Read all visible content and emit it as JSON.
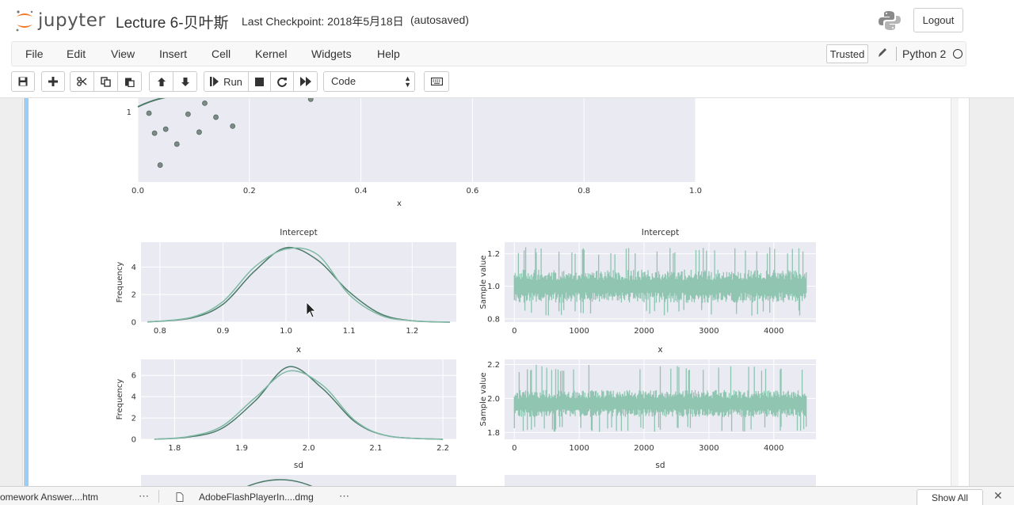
{
  "header": {
    "logo_text": "jupyter",
    "notebook_name": "Lecture 6-贝叶斯",
    "checkpoint": "Last Checkpoint: 2018年5月18日",
    "autosave_status": "(autosaved)",
    "logout_label": "Logout"
  },
  "menubar": {
    "items": [
      "File",
      "Edit",
      "View",
      "Insert",
      "Cell",
      "Kernel",
      "Widgets",
      "Help"
    ],
    "trusted_label": "Trusted",
    "kernel_name": "Python 2"
  },
  "toolbar": {
    "run_label": "Run",
    "cell_type": "Code",
    "icons": [
      "save-icon",
      "plus-icon",
      "scissors-icon",
      "copy-icon",
      "paste-icon",
      "arrow-up-icon",
      "arrow-down-icon",
      "run-icon",
      "stop-icon",
      "restart-icon",
      "fast-forward-icon",
      "keyboard-icon"
    ]
  },
  "downloads": {
    "items": [
      "omework Answer....htm",
      "AdobeFlashPlayerIn....dmg"
    ],
    "show_all_label": "Show All"
  },
  "chart_data": [
    {
      "type": "scatter",
      "title": "",
      "xlabel": "x",
      "ylabel": "",
      "xlim": [
        0.0,
        1.0
      ],
      "x_ticks": [
        "0.0",
        "0.2",
        "0.4",
        "0.6",
        "0.8",
        "1.0"
      ],
      "y_ticks": [
        "1"
      ],
      "points": [
        {
          "x": 0.02,
          "y": 0.99
        },
        {
          "x": 0.03,
          "y": 0.79
        },
        {
          "x": 0.04,
          "y": 0.47
        },
        {
          "x": 0.05,
          "y": 0.83
        },
        {
          "x": 0.07,
          "y": 0.68
        },
        {
          "x": 0.09,
          "y": 0.98
        },
        {
          "x": 0.11,
          "y": 0.8
        },
        {
          "x": 0.12,
          "y": 1.09
        },
        {
          "x": 0.14,
          "y": 0.95
        },
        {
          "x": 0.17,
          "y": 0.86
        },
        {
          "x": 0.31,
          "y": 1.13
        }
      ]
    },
    {
      "type": "line",
      "title": "Intercept",
      "xlabel": "",
      "ylabel": "Frequency",
      "xlim": [
        0.77,
        1.27
      ],
      "ylim": [
        0,
        5.8
      ],
      "x_ticks": [
        "0.8",
        "0.9",
        "1.0",
        "1.1",
        "1.2"
      ],
      "y_ticks": [
        "0",
        "2",
        "4"
      ],
      "series": [
        {
          "values": [
            {
              "x": 0.78,
              "y": 0.01
            },
            {
              "x": 0.85,
              "y": 0.3
            },
            {
              "x": 0.9,
              "y": 1.3
            },
            {
              "x": 0.95,
              "y": 3.7
            },
            {
              "x": 1.0,
              "y": 5.4
            },
            {
              "x": 1.05,
              "y": 4.5
            },
            {
              "x": 1.1,
              "y": 2.2
            },
            {
              "x": 1.15,
              "y": 0.6
            },
            {
              "x": 1.2,
              "y": 0.1
            },
            {
              "x": 1.26,
              "y": 0.0
            }
          ]
        },
        {
          "values": [
            {
              "x": 0.78,
              "y": 0.01
            },
            {
              "x": 0.85,
              "y": 0.35
            },
            {
              "x": 0.9,
              "y": 1.5
            },
            {
              "x": 0.95,
              "y": 4.0
            },
            {
              "x": 1.0,
              "y": 5.3
            },
            {
              "x": 1.05,
              "y": 4.9
            },
            {
              "x": 1.1,
              "y": 2.0
            },
            {
              "x": 1.15,
              "y": 0.5
            },
            {
              "x": 1.2,
              "y": 0.1
            },
            {
              "x": 1.26,
              "y": 0.0
            }
          ]
        }
      ]
    },
    {
      "type": "line",
      "title": "Intercept",
      "xlabel": "",
      "ylabel": "Sample value",
      "xlim": [
        -150,
        4650
      ],
      "ylim": [
        0.78,
        1.27
      ],
      "x_ticks": [
        "0",
        "1000",
        "2000",
        "3000",
        "4000"
      ],
      "y_ticks": [
        "0.8",
        "1.0",
        "1.2"
      ],
      "trace": {
        "n": 4500,
        "center": 1.0,
        "spread": 0.07,
        "min": 0.82,
        "max": 1.24
      }
    },
    {
      "type": "line",
      "title": "x",
      "xlabel": "",
      "ylabel": "Frequency",
      "xlim": [
        1.75,
        2.22
      ],
      "ylim": [
        0,
        7.5
      ],
      "x_ticks": [
        "1.8",
        "1.9",
        "2.0",
        "2.1",
        "2.2"
      ],
      "y_ticks": [
        "0",
        "2",
        "4",
        "6"
      ],
      "series": [
        {
          "values": [
            {
              "x": 1.77,
              "y": 0.01
            },
            {
              "x": 1.82,
              "y": 0.2
            },
            {
              "x": 1.87,
              "y": 1.0
            },
            {
              "x": 1.92,
              "y": 3.6
            },
            {
              "x": 1.97,
              "y": 6.8
            },
            {
              "x": 2.02,
              "y": 4.8
            },
            {
              "x": 2.07,
              "y": 1.6
            },
            {
              "x": 2.12,
              "y": 0.3
            },
            {
              "x": 2.2,
              "y": 0.0
            }
          ]
        },
        {
          "values": [
            {
              "x": 1.77,
              "y": 0.01
            },
            {
              "x": 1.82,
              "y": 0.25
            },
            {
              "x": 1.87,
              "y": 1.2
            },
            {
              "x": 1.92,
              "y": 3.9
            },
            {
              "x": 1.97,
              "y": 6.4
            },
            {
              "x": 2.02,
              "y": 5.1
            },
            {
              "x": 2.07,
              "y": 1.7
            },
            {
              "x": 2.12,
              "y": 0.3
            },
            {
              "x": 2.2,
              "y": 0.0
            }
          ]
        }
      ]
    },
    {
      "type": "line",
      "title": "x",
      "xlabel": "",
      "ylabel": "Sample value",
      "xlim": [
        -150,
        4650
      ],
      "ylim": [
        1.76,
        2.23
      ],
      "x_ticks": [
        "0",
        "1000",
        "2000",
        "3000",
        "4000"
      ],
      "y_ticks": [
        "1.8",
        "2.0",
        "2.2"
      ],
      "trace": {
        "n": 4500,
        "center": 1.97,
        "spread": 0.055,
        "min": 1.8,
        "max": 2.2
      }
    },
    {
      "type": "line",
      "title": "sd",
      "xlabel": "",
      "ylabel": "",
      "series": []
    },
    {
      "type": "line",
      "title": "sd",
      "xlabel": "",
      "ylabel": "",
      "trace": {}
    }
  ]
}
